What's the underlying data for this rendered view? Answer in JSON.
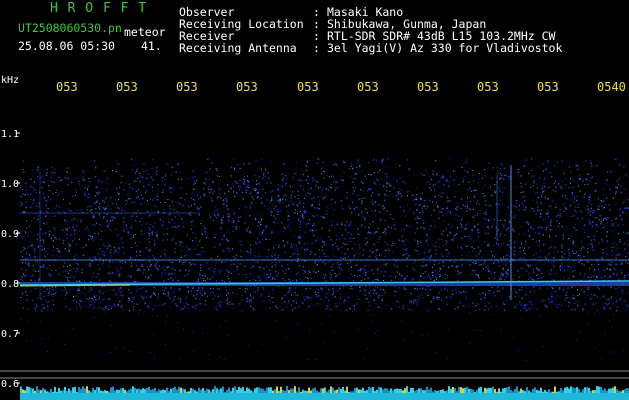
{
  "header": {
    "app_title": "H R O F F T",
    "filename": "UT2508060530.pn",
    "filetype": "meteor",
    "datetime": "25.08.06 05:30",
    "count": "41.",
    "fields": [
      {
        "label": "Observer",
        "value": "Masaki Kano"
      },
      {
        "label": "Receiving Location",
        "value": "Shibukawa, Gunma, Japan"
      },
      {
        "label": "Receiver",
        "value": "RTL-SDR SDR# 43dB L15 103.2MHz CW"
      },
      {
        "label": "Receiving Antenna",
        "value": "3el Yagi(V) Az 330 for Vladivostok"
      }
    ],
    "separator": ":"
  },
  "axis": {
    "unit": "kHz",
    "y_ticks": [
      "1.1",
      "1.0",
      "0.9",
      "0.8",
      "0.7",
      "0.6"
    ],
    "x_ticks": [
      "053",
      "053",
      "053",
      "053",
      "053",
      "053",
      "053",
      "053",
      "053",
      "0540"
    ]
  },
  "colors": {
    "background": "#000000",
    "label_text": "#ffffff",
    "title_text": "#33cc33",
    "time_text": "#e8e050",
    "noise": "#1a2aa0",
    "echo_line": "#40c8e0"
  }
}
